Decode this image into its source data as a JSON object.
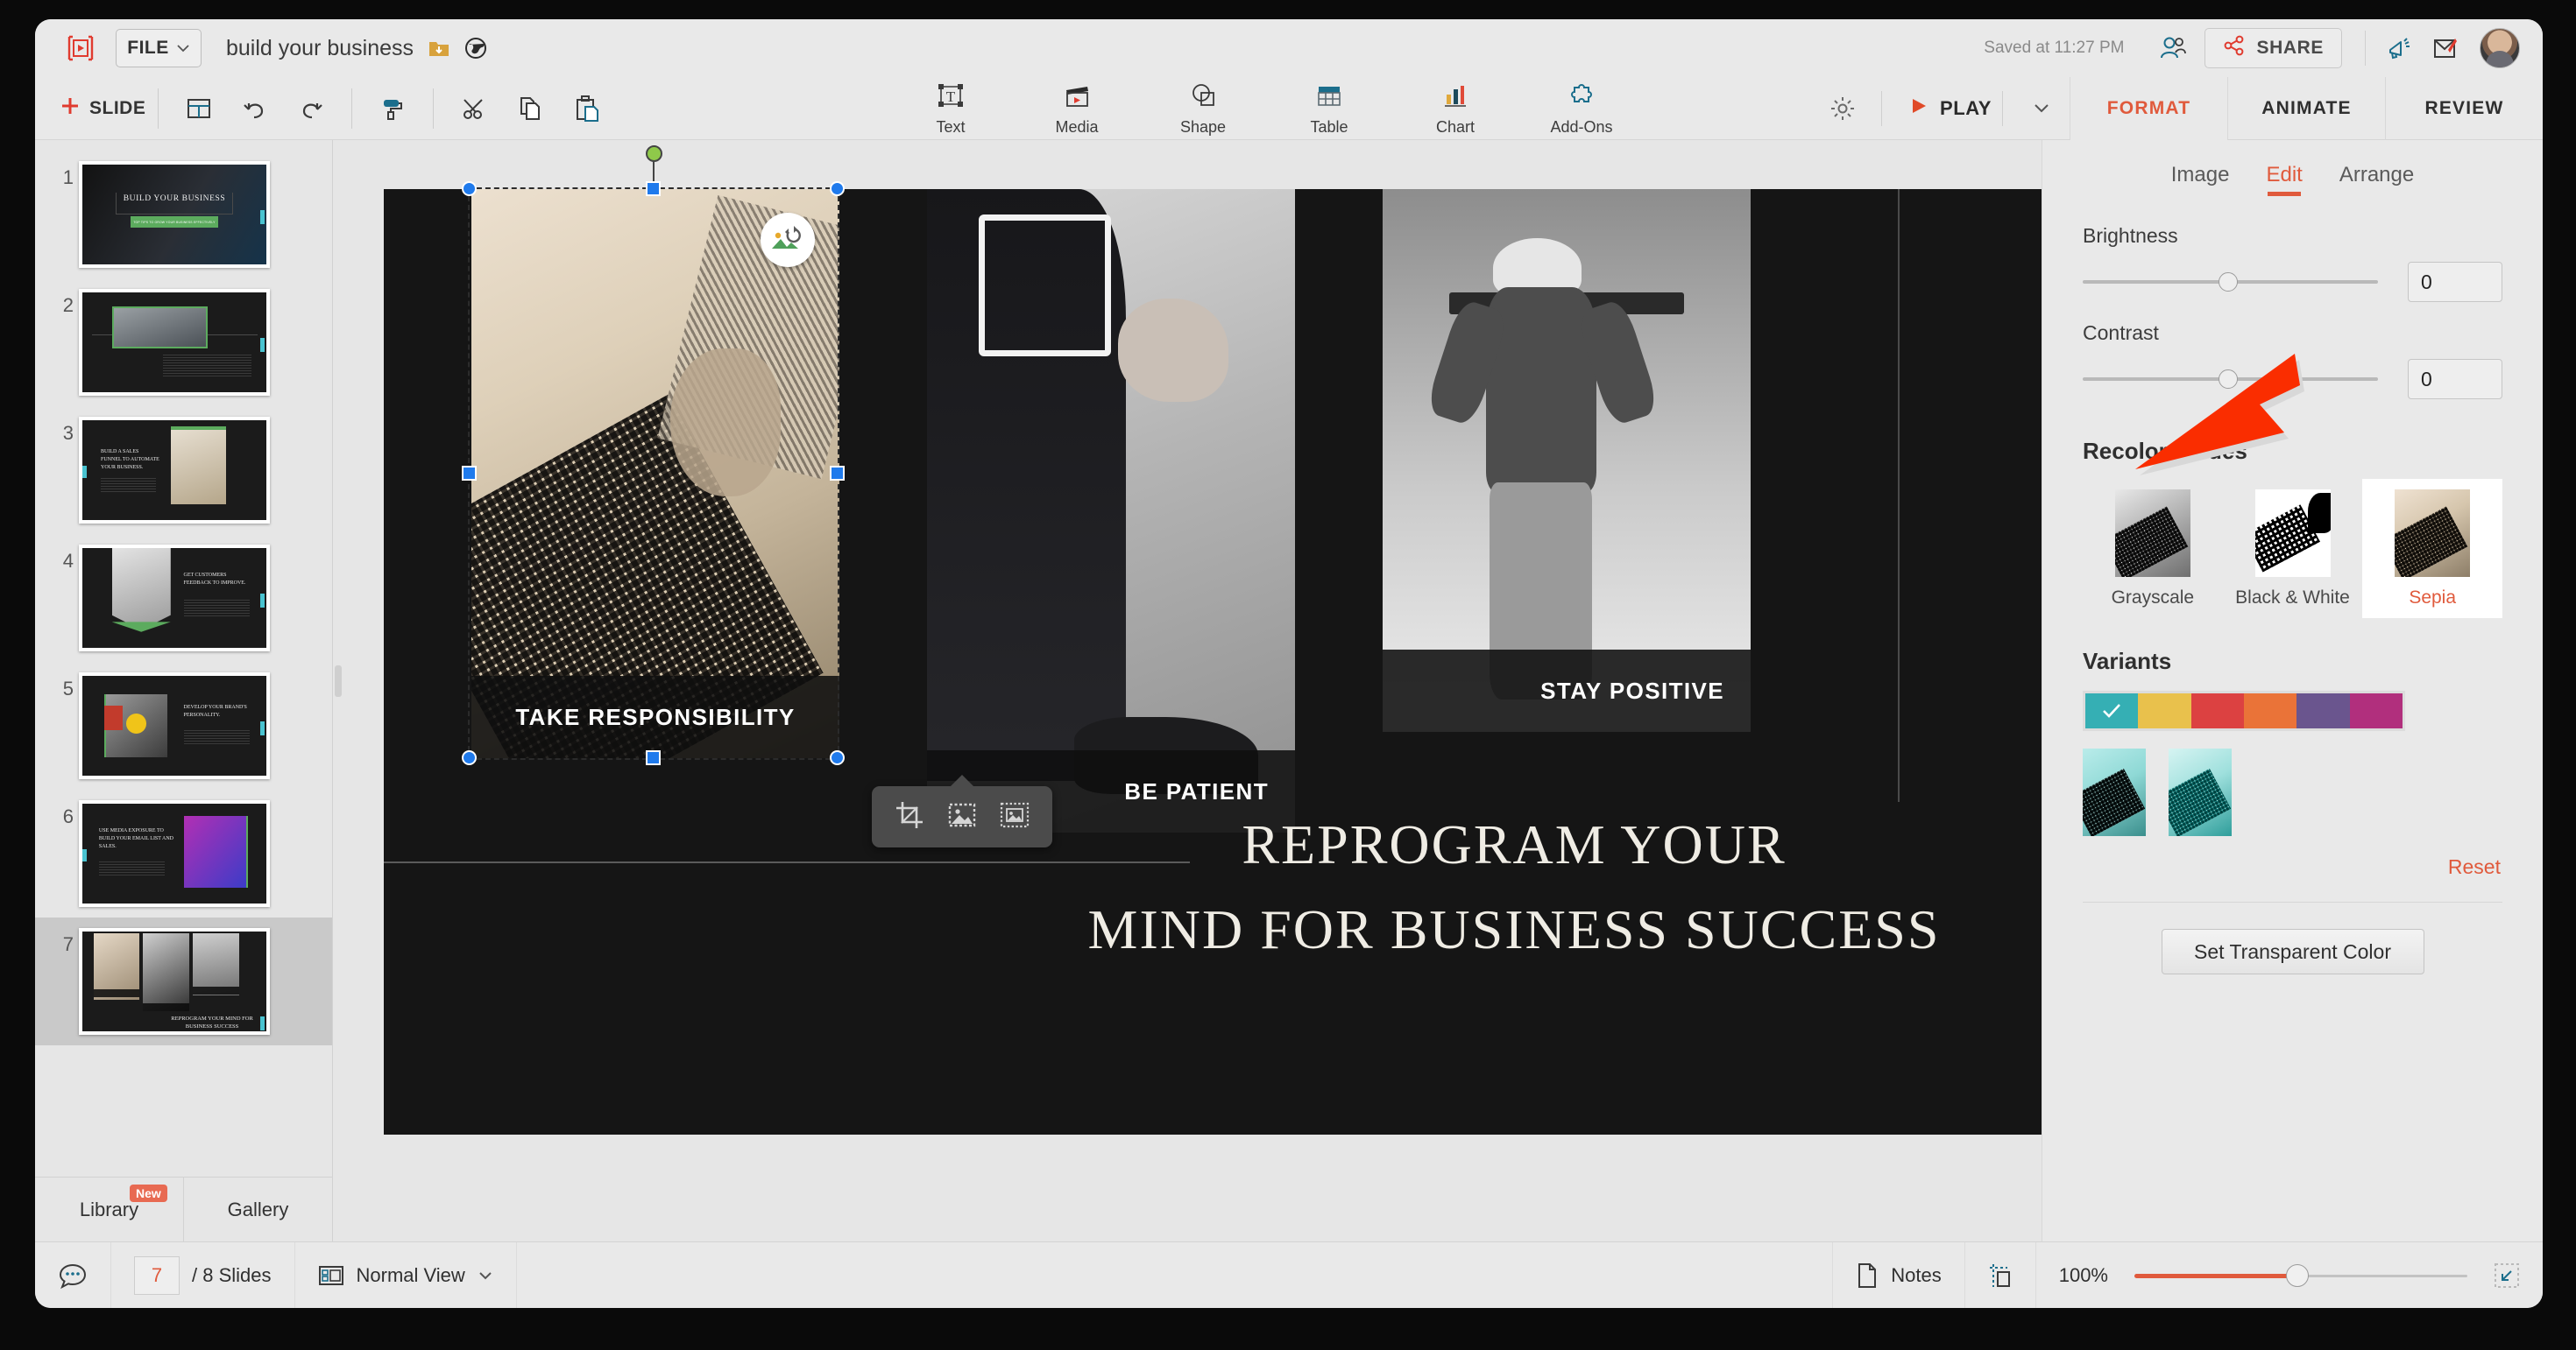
{
  "app": {
    "logo_icon": "presentation-logo-icon",
    "file_menu_label": "FILE",
    "document_title": "build your business",
    "title_folder_icon": "folder-download-icon",
    "title_globe_icon": "globe-icon",
    "saved_status": "Saved at 11:27 PM",
    "collab_icon": "collaborators-icon",
    "share_label": "SHARE",
    "share_icon": "share-nodes-icon",
    "announce_icon": "megaphone-icon",
    "feedback_icon": "edit-note-icon",
    "avatar_icon": "user-avatar"
  },
  "toolbar": {
    "add_slide_label": "SLIDE",
    "add_slide_icon": "plus-icon",
    "layout_icon": "slide-layout-icon",
    "undo_icon": "undo-icon",
    "redo_icon": "redo-icon",
    "format_painter_icon": "format-painter-icon",
    "cut_icon": "scissors-icon",
    "copy_icon": "copy-icon",
    "paste_icon": "paste-icon",
    "insert_tools": [
      {
        "label": "Text",
        "icon": "text-box-icon"
      },
      {
        "label": "Media",
        "icon": "media-clapperboard-icon"
      },
      {
        "label": "Shape",
        "icon": "shape-icon"
      },
      {
        "label": "Table",
        "icon": "table-icon"
      },
      {
        "label": "Chart",
        "icon": "bar-chart-icon"
      },
      {
        "label": "Add-Ons",
        "icon": "puzzle-piece-icon"
      }
    ],
    "settings_icon": "gear-icon",
    "play_label": "PLAY",
    "play_icon": "play-triangle-icon",
    "play_caret_icon": "chevron-down-icon"
  },
  "ribbon_tabs": [
    {
      "label": "FORMAT",
      "active": true
    },
    {
      "label": "ANIMATE",
      "active": false
    },
    {
      "label": "REVIEW",
      "active": false
    }
  ],
  "slides_panel": {
    "slides": [
      {
        "num": "1",
        "selected": false
      },
      {
        "num": "2",
        "selected": false
      },
      {
        "num": "3",
        "selected": false
      },
      {
        "num": "4",
        "selected": false
      },
      {
        "num": "5",
        "selected": false
      },
      {
        "num": "6",
        "selected": false
      },
      {
        "num": "7",
        "selected": true
      }
    ],
    "thumb_texts": {
      "s1_title": "BUILD YOUR BUSINESS",
      "s1_sub": "TOP TIPS TO GROW YOUR BUSINESS EFFECTIVELY",
      "s3_title": "BUILD A SALES FUNNEL TO AUTOMATE YOUR BUSINESS.",
      "s4_title": "GET CUSTOMERS FEEDBACK TO IMPROVE.",
      "s5_title": "DEVELOP YOUR BRAND'S PERSONALITY.",
      "s6_title": "USE MEDIA EXPOSURE TO BUILD YOUR EMAIL LIST AND SALES.",
      "s7_title": "REPROGRAM YOUR MIND FOR BUSINESS SUCCESS"
    },
    "tabs": [
      {
        "label": "Library",
        "badge": "New"
      },
      {
        "label": "Gallery",
        "badge": ""
      }
    ]
  },
  "slide": {
    "images": [
      {
        "caption": "TAKE RESPONSIBILITY",
        "name": "image-keyboard-sepia"
      },
      {
        "caption": "BE PATIENT",
        "name": "image-businessman-seated"
      },
      {
        "caption": "STAY POSITIVE",
        "name": "image-hiker"
      }
    ],
    "title_line1": "REPROGRAM YOUR",
    "title_line2": "MIND FOR BUSINESS SUCCESS",
    "replace_image_icon": "replace-image-icon",
    "float_toolbar": [
      {
        "icon": "crop-icon",
        "name": "crop-button"
      },
      {
        "icon": "mask-image-icon",
        "name": "mask-button"
      },
      {
        "icon": "fit-image-icon",
        "name": "fit-button"
      }
    ]
  },
  "format_panel": {
    "tabs": [
      {
        "label": "Image",
        "active": false
      },
      {
        "label": "Edit",
        "active": true
      },
      {
        "label": "Arrange",
        "active": false
      }
    ],
    "brightness": {
      "label": "Brightness",
      "value": "0"
    },
    "contrast": {
      "label": "Contrast",
      "value": "0"
    },
    "recolor_heading": "Recolor modes",
    "recolor_modes": [
      {
        "label": "Grayscale",
        "selected": false
      },
      {
        "label": "Black & White",
        "selected": false
      },
      {
        "label": "Sepia",
        "selected": true
      }
    ],
    "variants_heading": "Variants",
    "variant_swatches": [
      {
        "color": "#35afb4",
        "checked": true
      },
      {
        "color": "#e9c14c",
        "checked": false
      },
      {
        "color": "#dc4141",
        "checked": false
      },
      {
        "color": "#ea7338",
        "checked": false
      },
      {
        "color": "#6a558e",
        "checked": false
      },
      {
        "color": "#b12f7d",
        "checked": false
      }
    ],
    "reset_label": "Reset",
    "set_transparent_label": "Set Transparent Color"
  },
  "statusbar": {
    "comment_icon": "comment-icon",
    "current_slide": "7",
    "slide_count_label": "/ 8 Slides",
    "view_icon": "normal-view-icon",
    "view_label": "Normal View",
    "view_caret_icon": "chevron-down-icon",
    "notes_icon": "notes-page-icon",
    "notes_label": "Notes",
    "guides_icon": "guides-icon",
    "zoom_value": "100%",
    "fit_icon": "fit-to-screen-icon"
  },
  "colors": {
    "accent_red": "#e05a3c",
    "accent_teal": "#49c3d0",
    "panel_bg": "#e9e9e9",
    "slide_bg": "#151515"
  }
}
